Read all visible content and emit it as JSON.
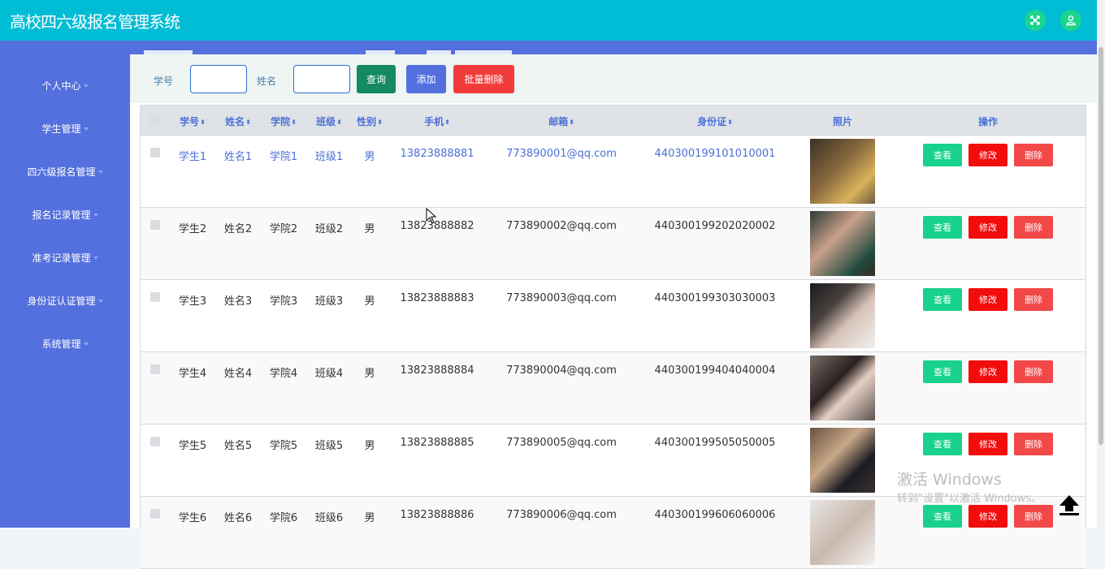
{
  "app": {
    "title": "高校四六级报名管理系统"
  },
  "header": {
    "fullscreen_icon": "fullscreen-icon",
    "user_icon": "user-icon"
  },
  "sidebar": {
    "items": [
      {
        "label": "个人中心"
      },
      {
        "label": "学生管理"
      },
      {
        "label": "四六级报名管理"
      },
      {
        "label": "报名记录管理"
      },
      {
        "label": "准考记录管理"
      },
      {
        "label": "身份证认证管理"
      },
      {
        "label": "系统管理"
      }
    ]
  },
  "search": {
    "student_no_label": "学号",
    "student_no_value": "",
    "name_label": "姓名",
    "name_value": "",
    "query_label": "查询",
    "add_label": "添加",
    "batch_delete_label": "批量删除"
  },
  "table": {
    "columns": [
      "学号",
      "姓名",
      "学院",
      "班级",
      "性别",
      "手机",
      "邮箱",
      "身份证",
      "照片",
      "操作"
    ],
    "actions": {
      "view": "查看",
      "edit": "修改",
      "delete": "删除"
    },
    "rows": [
      {
        "student_no": "学生1",
        "name": "姓名1",
        "college": "学院1",
        "class": "班级1",
        "gender": "男",
        "phone": "13823888881",
        "email": "773890001@qq.com",
        "id_card": "440300199101010001"
      },
      {
        "student_no": "学生2",
        "name": "姓名2",
        "college": "学院2",
        "class": "班级2",
        "gender": "男",
        "phone": "13823888882",
        "email": "773890002@qq.com",
        "id_card": "440300199202020002"
      },
      {
        "student_no": "学生3",
        "name": "姓名3",
        "college": "学院3",
        "class": "班级3",
        "gender": "男",
        "phone": "13823888883",
        "email": "773890003@qq.com",
        "id_card": "440300199303030003"
      },
      {
        "student_no": "学生4",
        "name": "姓名4",
        "college": "学院4",
        "class": "班级4",
        "gender": "男",
        "phone": "13823888884",
        "email": "773890004@qq.com",
        "id_card": "440300199404040004"
      },
      {
        "student_no": "学生5",
        "name": "姓名5",
        "college": "学院5",
        "class": "班级5",
        "gender": "男",
        "phone": "13823888885",
        "email": "773890005@qq.com",
        "id_card": "440300199505050005"
      },
      {
        "student_no": "学生6",
        "name": "姓名6",
        "college": "学院6",
        "class": "班级6",
        "gender": "男",
        "phone": "13823888886",
        "email": "773890006@qq.com",
        "id_card": "440300199606060006"
      }
    ]
  },
  "watermark": {
    "line1": "激活 Windows",
    "line2": "转到\"设置\"以激活 Windows。"
  },
  "colors": {
    "header": "#00bcd4",
    "sidebar": "#5470de",
    "query": "#138a5f",
    "add": "#5470de",
    "batch_delete": "#f23b3b",
    "view": "#19d18e",
    "edit": "#f20d0d",
    "delete": "#f24848",
    "link": "#4b6fd8"
  }
}
